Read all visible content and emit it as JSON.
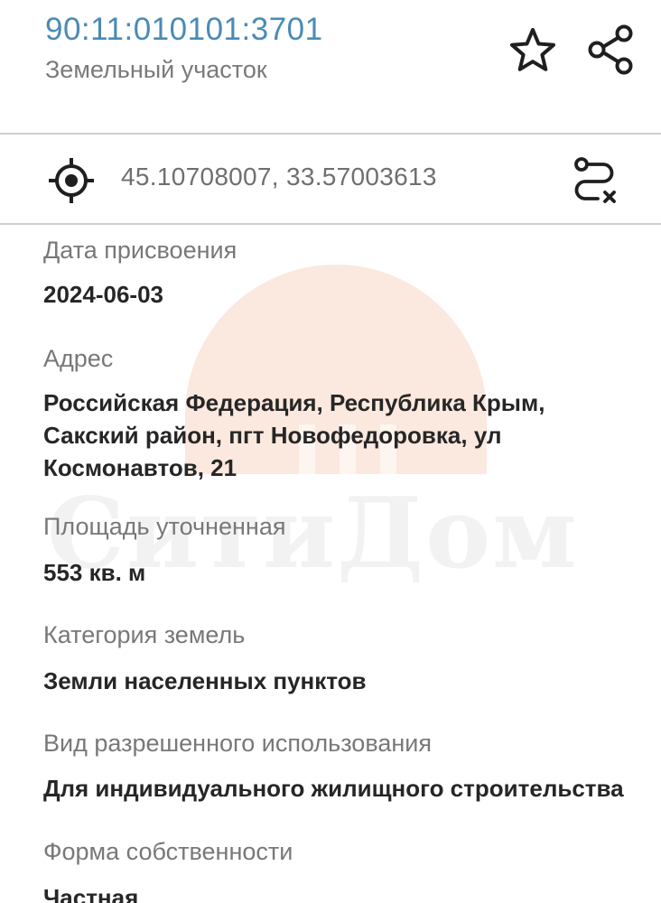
{
  "header": {
    "cadastral_number": "90:11:010101:3701",
    "object_type": "Земельный участок"
  },
  "coordinates": {
    "value": "45.10708007, 33.57003613"
  },
  "fields": [
    {
      "label": "Дата присвоения",
      "value": [
        "2024-06-03"
      ]
    },
    {
      "label": "Адрес",
      "value": [
        "Российская Федерация, Республика Крым,",
        "Сакский район, пгт Новофедоровка, ул",
        "Космонавтов, 21"
      ]
    },
    {
      "label": "Площадь уточненная",
      "value": [
        "553 кв. м"
      ]
    },
    {
      "label": "Категория земель",
      "value": [
        "Земли населенных пунктов"
      ]
    },
    {
      "label": "Вид разрешенного использования",
      "value": [
        "Для индивидуального жилищного строительства"
      ]
    },
    {
      "label": "Форма собственности",
      "value": [
        "Частная"
      ]
    }
  ],
  "watermark": {
    "text": "СитиДом"
  },
  "colors": {
    "accent": "#4a8bb6",
    "watermark_logo": "#f6c9b0",
    "icon": "#1f1f1f"
  },
  "icons": [
    "star-icon",
    "share-icon",
    "locate-icon",
    "route-icon"
  ]
}
